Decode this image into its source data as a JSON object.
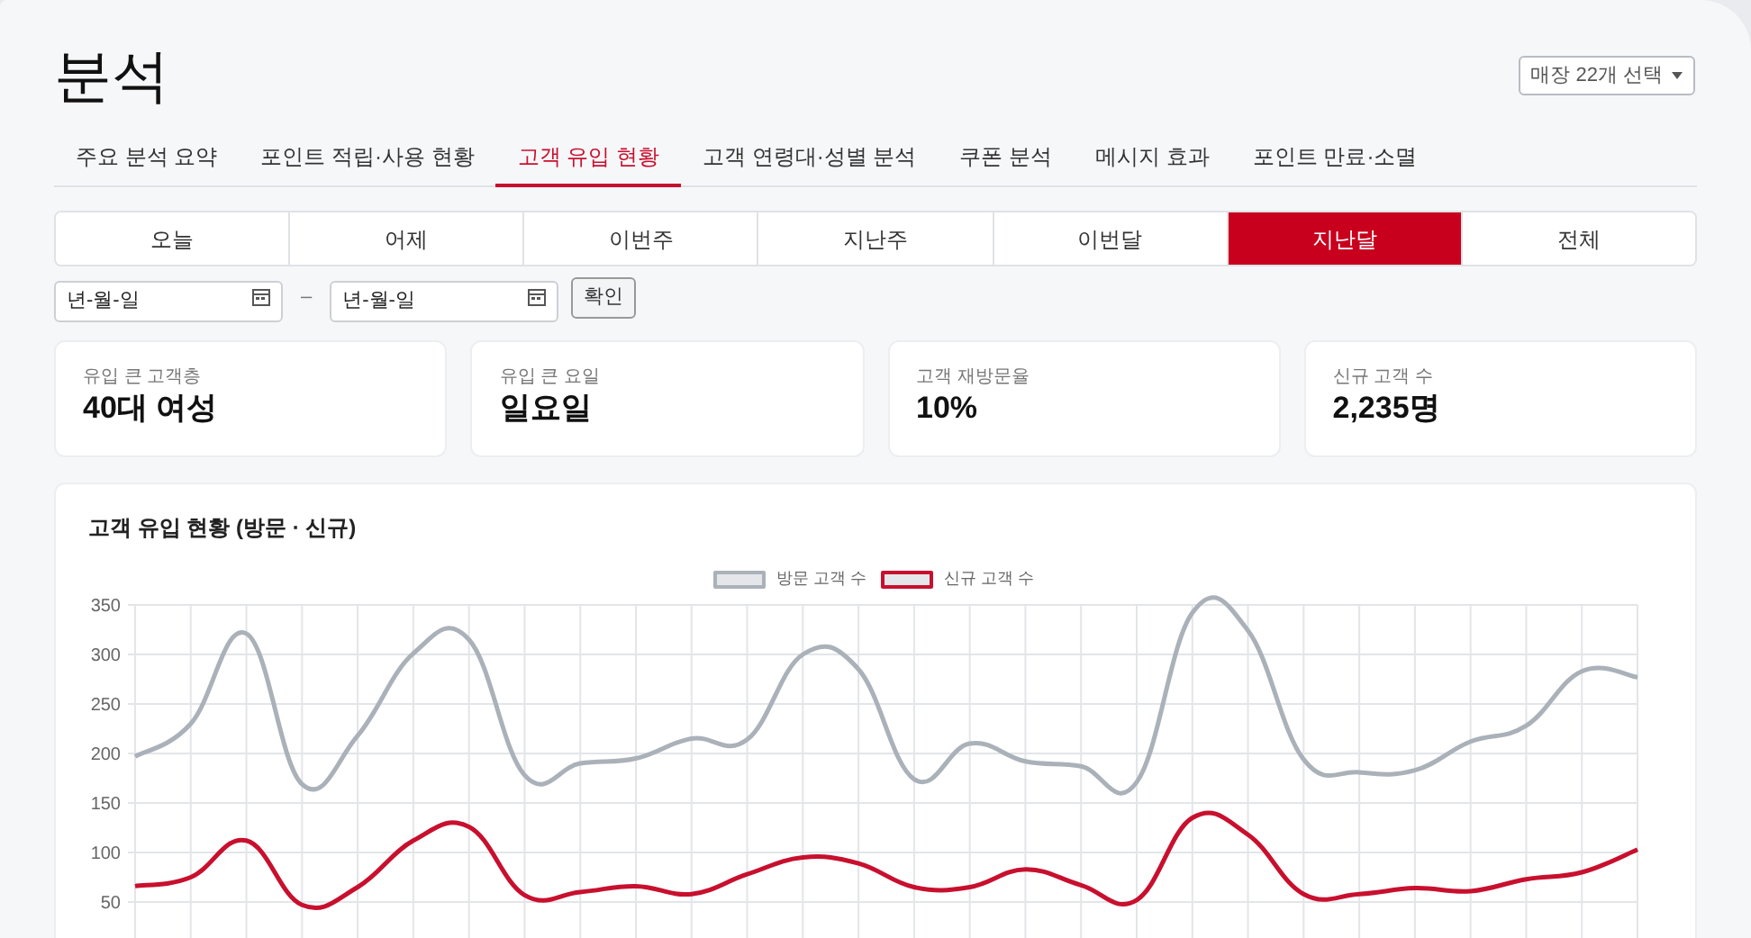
{
  "page": {
    "title": "분석"
  },
  "store_select": {
    "label": "매장 22개 선택"
  },
  "tabs": [
    {
      "label": "주요 분석 요약",
      "selected": false
    },
    {
      "label": "포인트 적립·사용 현황",
      "selected": false
    },
    {
      "label": "고객 유입 현황",
      "selected": true
    },
    {
      "label": "고객 연령대·성별 분석",
      "selected": false
    },
    {
      "label": "쿠폰 분석",
      "selected": false
    },
    {
      "label": "메시지 효과",
      "selected": false
    },
    {
      "label": "포인트 만료·소멸",
      "selected": false
    }
  ],
  "periods": [
    {
      "label": "오늘",
      "selected": false
    },
    {
      "label": "어제",
      "selected": false
    },
    {
      "label": "이번주",
      "selected": false
    },
    {
      "label": "지난주",
      "selected": false
    },
    {
      "label": "이번달",
      "selected": false
    },
    {
      "label": "지난달",
      "selected": true
    },
    {
      "label": "전체",
      "selected": false
    }
  ],
  "date_range": {
    "start": {
      "placeholder": "년-월-일"
    },
    "separator": "–",
    "end": {
      "placeholder": "년-월-일"
    },
    "confirm_button": "확인"
  },
  "stats": [
    {
      "label": "유입 큰 고객층",
      "value": "40대 여성"
    },
    {
      "label": "유입 큰 요일",
      "value": "일요일"
    },
    {
      "label": "고객 재방문율",
      "value": "10%"
    },
    {
      "label": "신규 고객 수",
      "value": "2,235명"
    }
  ],
  "chart_card": {
    "title": "고객 유입 현황 (방문 · 신규)",
    "chart_data": {
      "type": "line",
      "grid": true,
      "ylim": [
        10,
        350
      ],
      "yticks": [
        50,
        100,
        150,
        200,
        250,
        300,
        350
      ],
      "series": [
        {
          "name": "방문 고객 수",
          "color": "#aab1b9",
          "values": [
            197,
            230,
            321,
            169,
            218,
            301,
            315,
            178,
            190,
            195,
            215,
            214,
            300,
            285,
            174,
            210,
            192,
            187,
            171,
            342,
            324,
            194,
            181,
            183,
            212,
            228,
            283,
            277
          ]
        },
        {
          "name": "신규 고객 수",
          "color": "#c8102e",
          "values": [
            66,
            75,
            112,
            47,
            65,
            112,
            126,
            57,
            60,
            66,
            58,
            78,
            95,
            89,
            65,
            65,
            83,
            67,
            52,
            135,
            118,
            58,
            58,
            64,
            61,
            73,
            80,
            103
          ]
        }
      ]
    }
  }
}
